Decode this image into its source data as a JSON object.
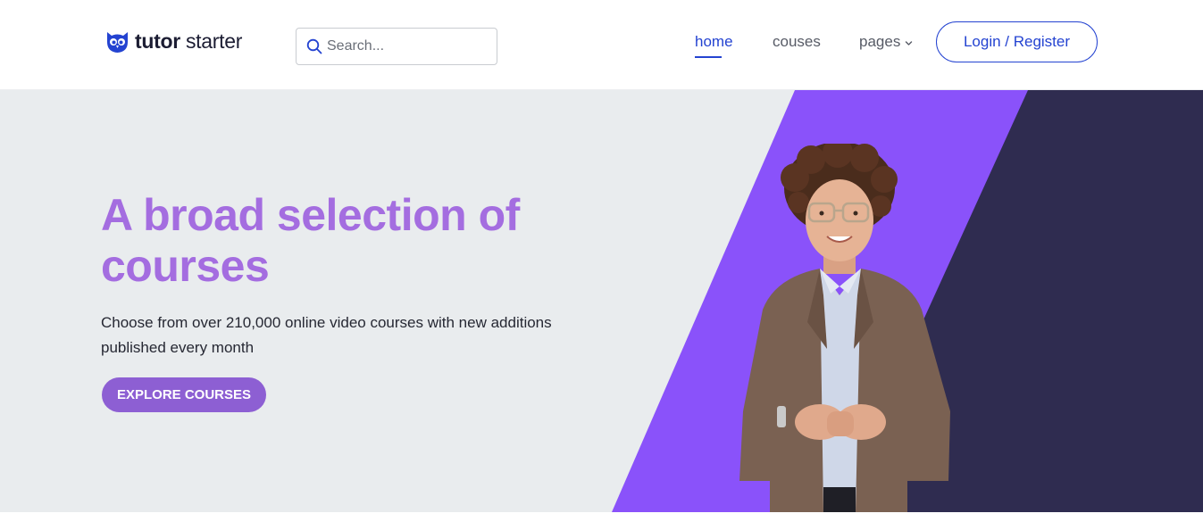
{
  "header": {
    "logo_bold": "tutor",
    "logo_regular": " starter",
    "logo_icon": "owl-icon",
    "search_placeholder": "Search...",
    "search_icon": "search-icon",
    "nav": {
      "home": "home",
      "courses": "couses",
      "pages": "pages"
    },
    "pages_icon": "chevron-down-icon",
    "login_label": "Login / Register"
  },
  "hero": {
    "title": "A broad selection of courses",
    "subtitle": "Choose from over 210,000 online video courses with new additions published every month",
    "cta_label": "EXPLORE COURSES"
  },
  "colors": {
    "brand_blue": "#2443d1",
    "title_purple": "#a46de0",
    "cta_purple": "#8d5fd3",
    "stripe_purple": "#8a52fa",
    "stripe_dark": "#2f2c50",
    "hero_bg": "#e9ecee"
  }
}
